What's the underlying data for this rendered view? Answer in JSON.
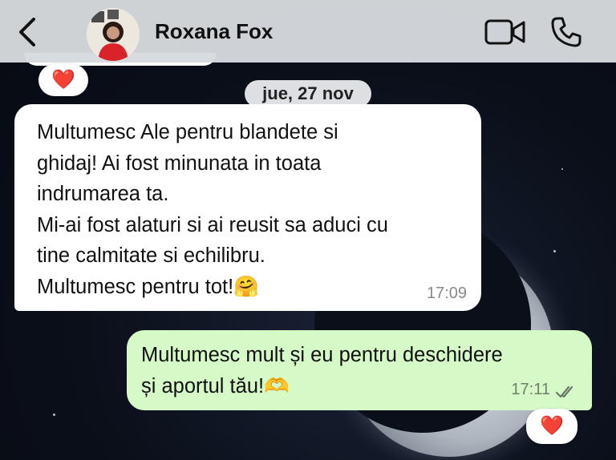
{
  "header": {
    "contact_name": "Roxana Fox"
  },
  "date_separator": "jue, 27 nov",
  "messages": [
    {
      "direction": "incoming",
      "text": "Multumesc Ale pentru blandete si\nghidaj! Ai fost minunata in toata\nindrumarea ta.\nMi-ai fost alaturi si ai reusit sa aduci cu\ntine calmitate si echilibru.\nMultumesc pentru tot!🤗",
      "time": "17:09"
    },
    {
      "direction": "outgoing",
      "text": "Multumesc mult și eu pentru deschidere\nși aportul tău!🫶",
      "time": "17:11",
      "status": "read"
    }
  ],
  "reactions": {
    "previous_message": "❤️",
    "outgoing_message": "❤️"
  },
  "colors": {
    "outgoing_bubble": "#d5f9c7",
    "incoming_bubble": "#ffffff",
    "header": "#d6dbde",
    "heart": "#e0203a"
  },
  "icons": [
    "back-chevron-icon",
    "video-call-icon",
    "phone-call-icon",
    "double-check-icon",
    "heart-icon"
  ]
}
